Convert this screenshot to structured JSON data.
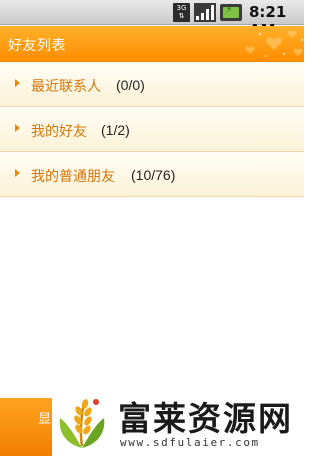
{
  "status_bar": {
    "network_label": "3G",
    "signal_icon": "signal-bars-icon",
    "battery_icon": "battery-charging-icon",
    "time": "8:21 AM"
  },
  "title_bar": {
    "title": "好友列表",
    "decoration_icon": "hearts-decoration-icon"
  },
  "groups": [
    {
      "name": "最近联系人",
      "count": "(0/0)"
    },
    {
      "name": "我的好友",
      "count": "(1/2)"
    },
    {
      "name": "我的普通朋友",
      "count": "(10/76)"
    }
  ],
  "bottom_bar": {
    "button_label_partial": "显示"
  },
  "watermark": {
    "title": "富莱资源网",
    "url": "www.sdfulaier.com",
    "logo_icon": "wheat-leaf-logo-icon"
  },
  "colors": {
    "accent_orange": "#ff9a10",
    "group_text": "#d8760a",
    "row_background": "#fdf6e0"
  }
}
